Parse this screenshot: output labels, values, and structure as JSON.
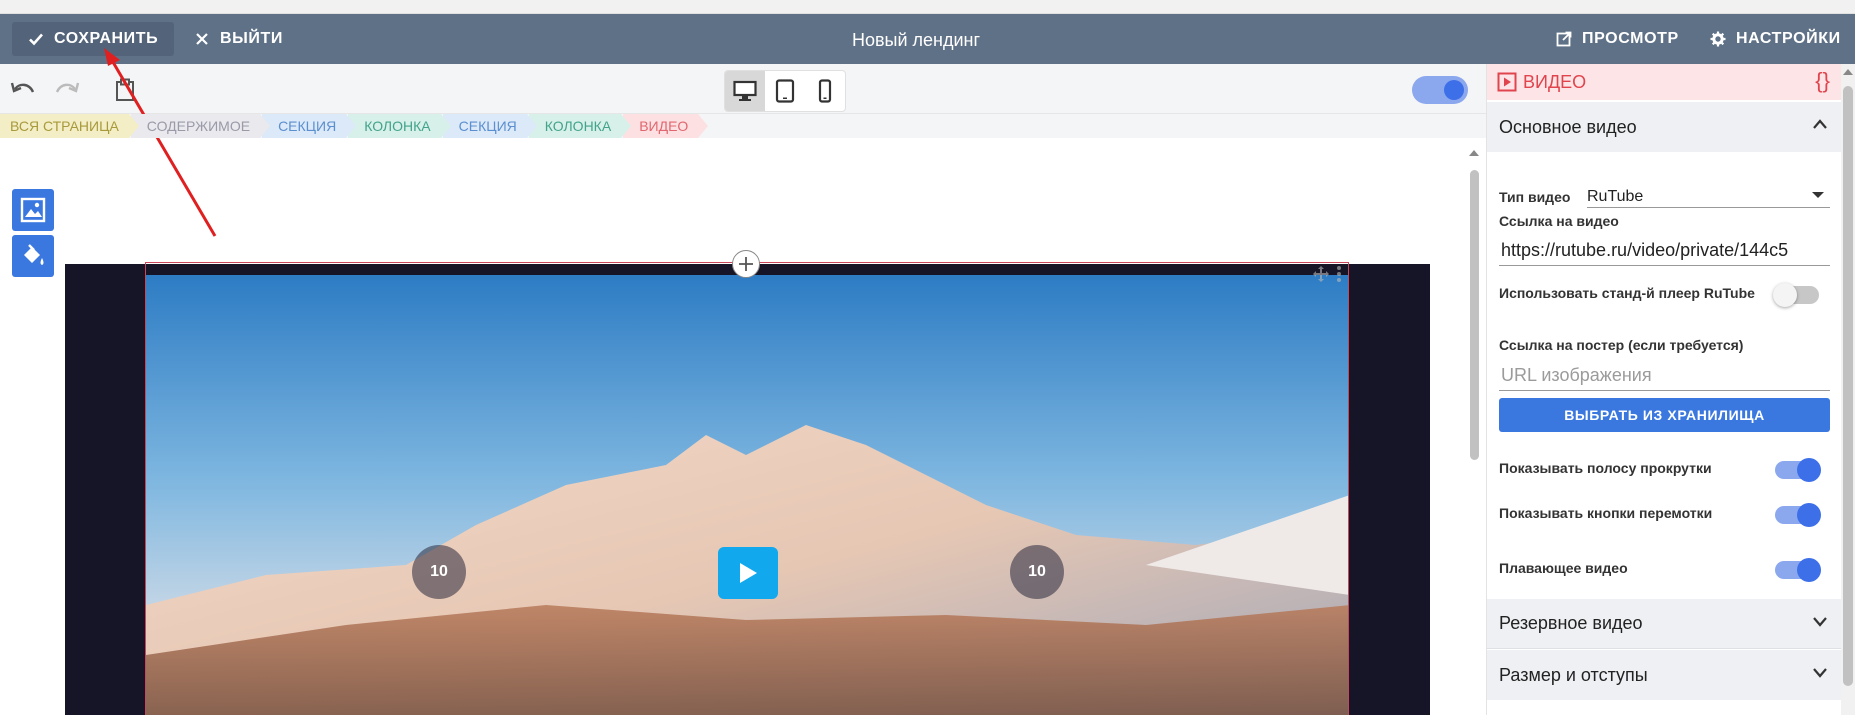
{
  "topbar": {
    "save_label": "СОХРАНИТЬ",
    "exit_label": "ВЫЙТИ",
    "title": "Новый лендинг",
    "preview_label": "ПРОСМОТР",
    "settings_label": "НАСТРОЙКИ"
  },
  "toolbar": {
    "icons": [
      "undo-icon",
      "redo-icon",
      "clipboard-icon"
    ],
    "devices": [
      "desktop-icon",
      "tablet-icon",
      "phone-icon"
    ],
    "active_device": "desktop",
    "edit_mode_toggle": true
  },
  "breadcrumbs": [
    {
      "label": "ВСЯ СТРАНИЦА",
      "color": "#f3eec6",
      "text": "#a89a3c"
    },
    {
      "label": "СОДЕРЖИМОЕ",
      "color": "#e9e9ee",
      "text": "#9a9aa8"
    },
    {
      "label": "СЕКЦИЯ",
      "color": "#dce9f8",
      "text": "#5b8fd0"
    },
    {
      "label": "КОЛОНКА",
      "color": "#d8f0ea",
      "text": "#43a38a"
    },
    {
      "label": "СЕКЦИЯ",
      "color": "#dce9f8",
      "text": "#5b8fd0"
    },
    {
      "label": "КОЛОНКА",
      "color": "#d8f0ea",
      "text": "#43a38a"
    },
    {
      "label": "ВИДЕО",
      "color": "#fde0e2",
      "text": "#e0676f"
    }
  ],
  "player": {
    "skip_back": "10",
    "skip_forward": "10"
  },
  "panel": {
    "header": "ВИДЕО",
    "braces": "{}",
    "main_section": "Основное видео",
    "video_type_label": "Тип видео",
    "video_type_value": "RuTube",
    "video_url_label": "Ссылка на видео",
    "video_url_value": "https://rutube.ru/video/private/144c5",
    "std_player_label": "Использовать станд-й плеер RuTube",
    "std_player_on": false,
    "poster_label": "Ссылка на постер (если требуется)",
    "poster_placeholder": "URL изображения",
    "choose_storage": "ВЫБРАТЬ ИЗ ХРАНИЛИЩА",
    "show_scrollbar_label": "Показывать полосу прокрутки",
    "show_scrollbar_on": true,
    "show_seek_label": "Показывать кнопки перемотки",
    "show_seek_on": true,
    "floating_label": "Плавающее видео",
    "floating_on": true,
    "backup_section": "Резервное видео",
    "size_section": "Размер и отступы"
  },
  "colors": {
    "topbar": "#5f7187",
    "accent": "#3a78e0",
    "danger": "#e0454e",
    "annotation_arrow": "#e02020"
  }
}
